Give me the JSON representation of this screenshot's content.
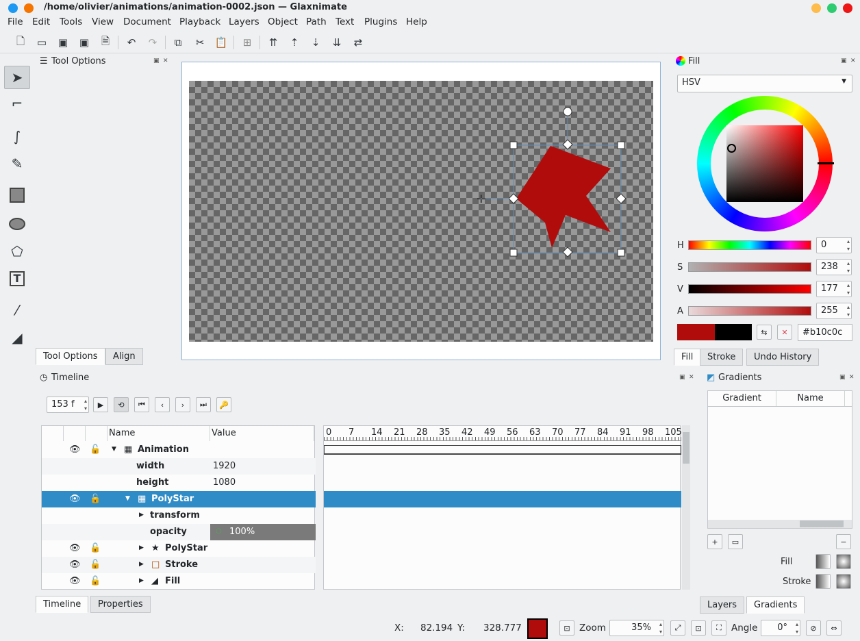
{
  "window": {
    "title": "/home/olivier/animations/animation-0002.json — Glaxnimate"
  },
  "menu": [
    "File",
    "Edit",
    "Tools",
    "View",
    "Document",
    "Playback",
    "Layers",
    "Object",
    "Path",
    "Text",
    "Plugins",
    "Help"
  ],
  "tool_options": {
    "title": "Tool Options",
    "tabs": [
      "Tool Options",
      "Align"
    ]
  },
  "fill_panel": {
    "title": "Fill",
    "mode": "HSV",
    "h_label": "H",
    "h": "0",
    "s_label": "S",
    "s": "238",
    "v_label": "V",
    "v": "177",
    "a_label": "A",
    "a": "255",
    "hex": "#b10c0c",
    "tabs": [
      "Fill",
      "Stroke",
      "Undo History"
    ],
    "colors": {
      "fill": "#b10c0c",
      "secondary": "#000000"
    }
  },
  "timeline": {
    "title": "Timeline",
    "frame": "153 f",
    "col_name": "Name",
    "col_value": "Value",
    "ruler": [
      "0",
      "7",
      "14",
      "21",
      "28",
      "35",
      "42",
      "49",
      "56",
      "63",
      "70",
      "77",
      "84",
      "91",
      "98",
      "105"
    ],
    "rows": {
      "animation": "Animation",
      "width_label": "width",
      "width": "1920",
      "height_label": "height",
      "height": "1080",
      "polystar_group": "PolyStar",
      "transform": "transform",
      "opacity_label": "opacity",
      "opacity": "100%",
      "polystar": "PolyStar",
      "stroke": "Stroke",
      "fill": "Fill"
    },
    "tabs": [
      "Timeline",
      "Properties"
    ]
  },
  "gradients": {
    "title": "Gradients",
    "col_gradient": "Gradient",
    "col_name": "Name",
    "fill_label": "Fill",
    "stroke_label": "Stroke",
    "tabs": [
      "Layers",
      "Gradients"
    ]
  },
  "status": {
    "x_label": "X:",
    "x": "82.194",
    "y_label": "Y:",
    "y": "328.777",
    "zoom_label": "Zoom",
    "zoom": "35%",
    "angle_label": "Angle",
    "angle": "0°"
  },
  "star_color": "#b10c0c",
  "accent": "#308cc6"
}
